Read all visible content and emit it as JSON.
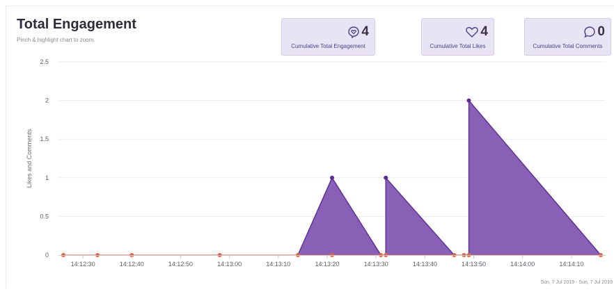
{
  "header": {
    "title": "Total Engagement",
    "subtitle": "Pinch & highlight chart to zoom."
  },
  "stats": [
    {
      "value": "4",
      "label": "Cumulative Total Engagement",
      "icon": "engagement-icon"
    },
    {
      "value": "4",
      "label": "Cumulative Total Likes",
      "icon": "heart-icon"
    },
    {
      "value": "0",
      "label": "Cumulative Total Comments",
      "icon": "comment-icon"
    }
  ],
  "footer": {
    "date_range": "Sun, 7 Jul 2019 - Sun, 7 Jul 2019"
  },
  "colors": {
    "likes_fill": "#7b4fae",
    "likes_stroke": "#5b2d94",
    "comments_line": "#e8735a",
    "comments_point": "#e0623f",
    "grid": "#ececf1",
    "stat_bg": "#e9e4f3"
  },
  "chart_data": {
    "type": "area",
    "ylabel": "Likes and Comments",
    "xlabel": "",
    "ylim": [
      0,
      2.5
    ],
    "yticks": [
      "0",
      "0.5",
      "1",
      "1.5",
      "2",
      "2.5"
    ],
    "xlim": [
      "14:12:25",
      "14:14:17"
    ],
    "xticks": [
      "14:12:30",
      "14:12:40",
      "14:12:50",
      "14:13:00",
      "14:13:10",
      "14:13:20",
      "14:13:30",
      "14:13:40",
      "14:13:50",
      "14:14:00",
      "14:14:10"
    ],
    "grid": true,
    "series": [
      {
        "x": [
          "14:13:14",
          "14:13:21",
          "14:13:31",
          "14:13:46",
          "14:13:49",
          "14:14:16"
        ],
        "y": [
          0,
          1,
          0,
          0,
          2,
          0
        ],
        "breaks": [
          2,
          3
        ],
        "starts": [
          "14:13:14",
          "14:13:32",
          "14:13:49"
        ],
        "peaks": [
          [
            "14:13:21",
            1
          ],
          [
            "14:13:32",
            1
          ],
          [
            "14:13:49",
            2
          ]
        ],
        "ends": [
          "14:13:31",
          "14:13:46",
          "14:14:16"
        ]
      },
      {
        "x": [
          "14:12:26",
          "14:12:33",
          "14:12:40",
          "14:12:58",
          "14:13:14",
          "14:13:21",
          "14:13:31",
          "14:13:32",
          "14:13:46",
          "14:13:48",
          "14:13:49",
          "14:14:16"
        ],
        "y": [
          0,
          0,
          0,
          0,
          0,
          0,
          0,
          0,
          0,
          0,
          0,
          0
        ]
      }
    ]
  }
}
